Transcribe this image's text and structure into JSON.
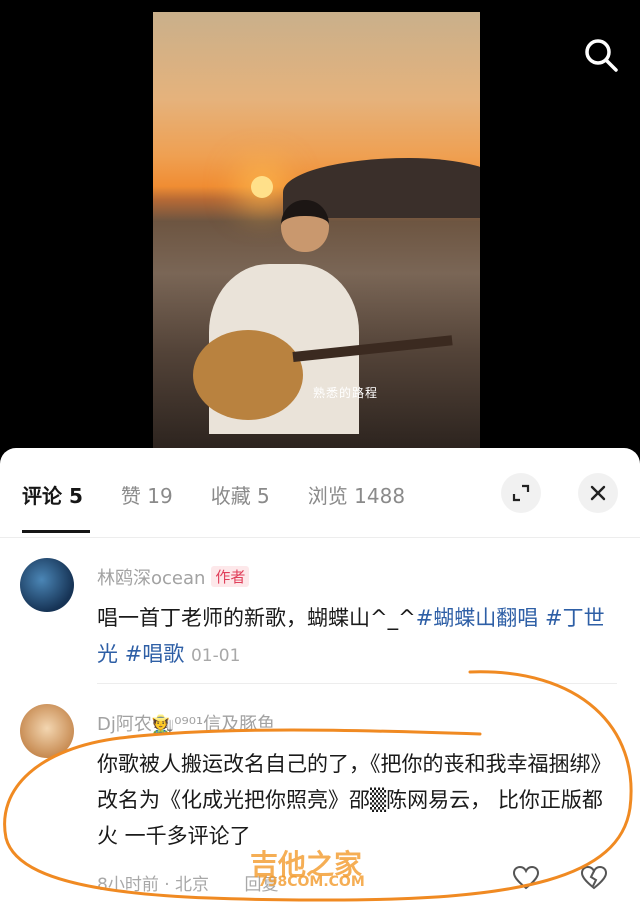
{
  "video": {
    "caption": "熟悉的路程"
  },
  "tabs": [
    {
      "label": "评论 5",
      "active": true
    },
    {
      "label": "赞 19"
    },
    {
      "label": "收藏 5"
    },
    {
      "label": "浏览 1488"
    }
  ],
  "comments": [
    {
      "author": "林鸥深ocean",
      "tag": "作者",
      "text": "唱一首丁老师的新歌，蝴蝶山^_^",
      "hashtags": [
        "#蝴蝶山翻唱",
        "#丁世光",
        "#唱歌"
      ],
      "date": "01-01"
    },
    {
      "author": "Dj阿农🧑‍🌾⁰⁹⁰¹信及豚鱼",
      "text": "你歌被人搬运改名自己的了，《把你的丧和我幸福捆绑》改名为《化成光把你照亮》邵▒陈网易云， 比你正版都火 一千多评论了",
      "time": "8小时前",
      "location": "北京",
      "reply": "回复"
    }
  ],
  "watermark": {
    "main": "吉他之家",
    "sub": "798COM.COM"
  },
  "colors": {
    "hashtag": "#2e5fa6",
    "annotation": "#f08a22",
    "author_tag": "#e0405b"
  }
}
